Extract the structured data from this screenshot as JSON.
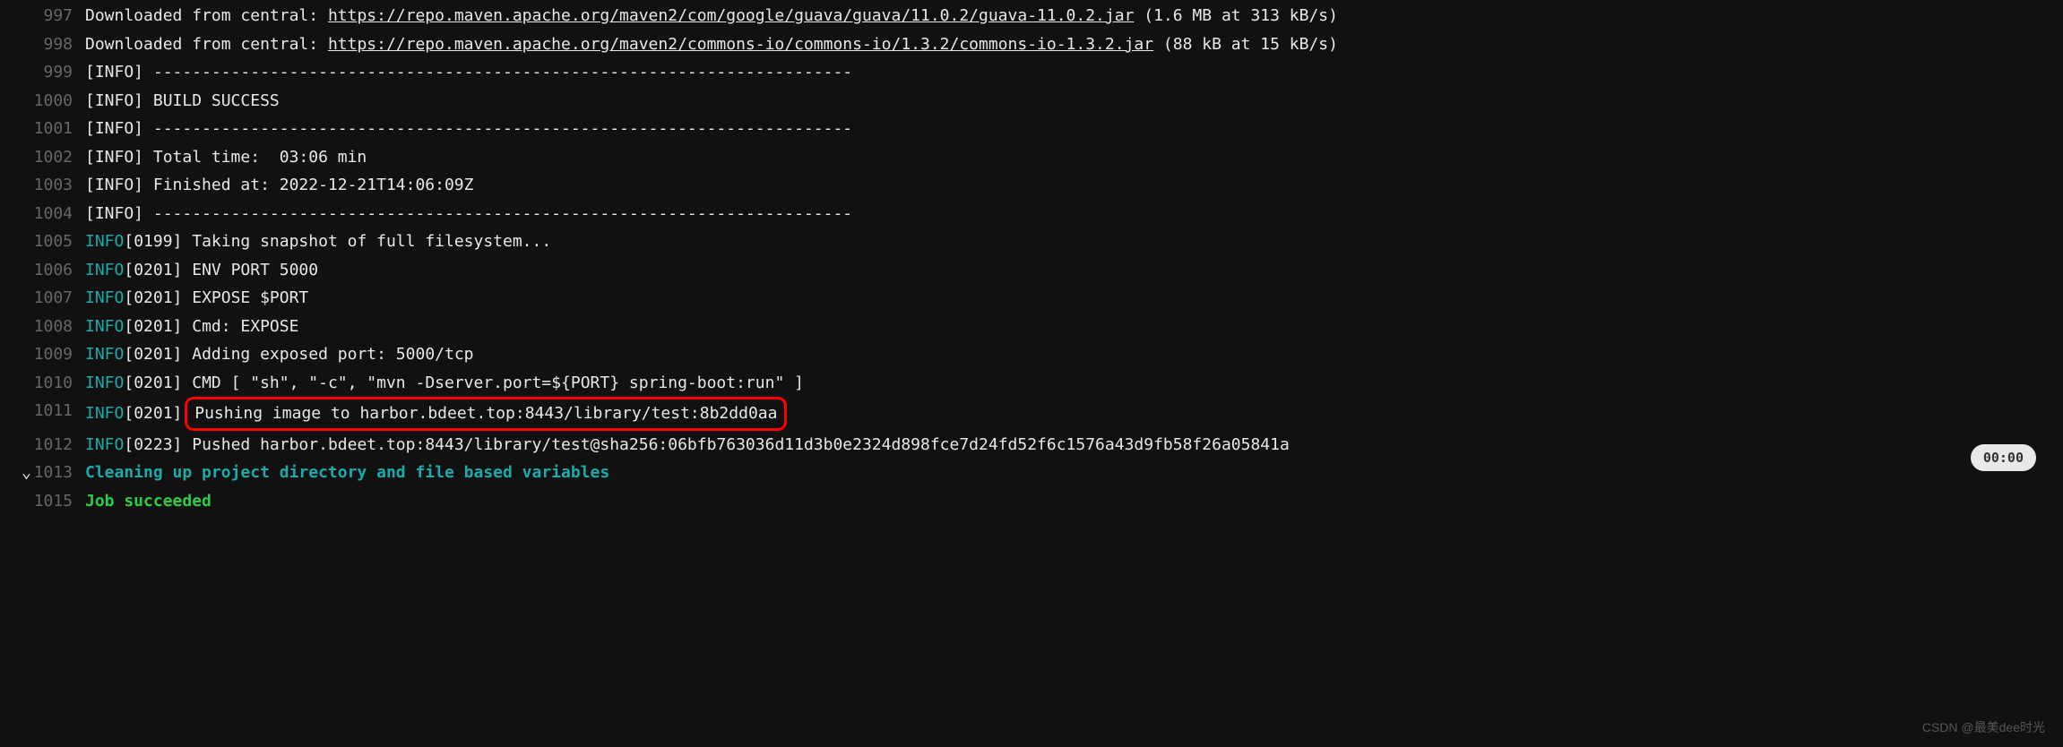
{
  "lines": [
    {
      "num": "997",
      "type": "download",
      "prefix": "Downloaded from central: ",
      "url": "https://repo.maven.apache.org/maven2/com/google/guava/guava/11.0.2/guava-11.0.2.jar",
      "suffix": " (1.6 MB at 313 kB/s)"
    },
    {
      "num": "998",
      "type": "download",
      "prefix": "Downloaded from central: ",
      "url": "https://repo.maven.apache.org/maven2/commons-io/commons-io/1.3.2/commons-io-1.3.2.jar",
      "suffix": " (88 kB at 15 kB/s)"
    },
    {
      "num": "999",
      "type": "plain",
      "text": "[INFO] ------------------------------------------------------------------------"
    },
    {
      "num": "1000",
      "type": "plain",
      "text": "[INFO] BUILD SUCCESS"
    },
    {
      "num": "1001",
      "type": "plain",
      "text": "[INFO] ------------------------------------------------------------------------"
    },
    {
      "num": "1002",
      "type": "plain",
      "text": "[INFO] Total time:  03:06 min"
    },
    {
      "num": "1003",
      "type": "plain",
      "text": "[INFO] Finished at: 2022-12-21T14:06:09Z"
    },
    {
      "num": "1004",
      "type": "plain",
      "text": "[INFO] ------------------------------------------------------------------------"
    },
    {
      "num": "1005",
      "type": "info",
      "code": "[0199]",
      "text": " Taking snapshot of full filesystem..."
    },
    {
      "num": "1006",
      "type": "info",
      "code": "[0201]",
      "text": " ENV PORT 5000"
    },
    {
      "num": "1007",
      "type": "info",
      "code": "[0201]",
      "text": " EXPOSE $PORT"
    },
    {
      "num": "1008",
      "type": "info",
      "code": "[0201]",
      "text": " Cmd: EXPOSE"
    },
    {
      "num": "1009",
      "type": "info",
      "code": "[0201]",
      "text": " Adding exposed port: 5000/tcp"
    },
    {
      "num": "1010",
      "type": "info",
      "code": "[0201]",
      "text": " CMD [ \"sh\", \"-c\", \"mvn -Dserver.port=${PORT} spring-boot:run\" ]"
    },
    {
      "num": "1011",
      "type": "info-highlight",
      "code": "[0201]",
      "text": " Pushing image to harbor.bdeet.top:8443/library/test:8b2dd0aa"
    },
    {
      "num": "1012",
      "type": "info",
      "code": "[0223]",
      "text": " Pushed harbor.bdeet.top:8443/library/test@sha256:06bfb763036d11d3b0e2324d898fce7d24fd52f6c1576a43d9fb58f26a05841a"
    },
    {
      "num": "1013",
      "type": "section",
      "text": "Cleaning up project directory and file based variables",
      "chevron": true
    },
    {
      "num": "1015",
      "type": "success",
      "text": "Job succeeded"
    }
  ],
  "info_label": "INFO",
  "time_badge": "00:00",
  "watermark": "CSDN @最美dee时光",
  "chevron_glyph": "⌄"
}
